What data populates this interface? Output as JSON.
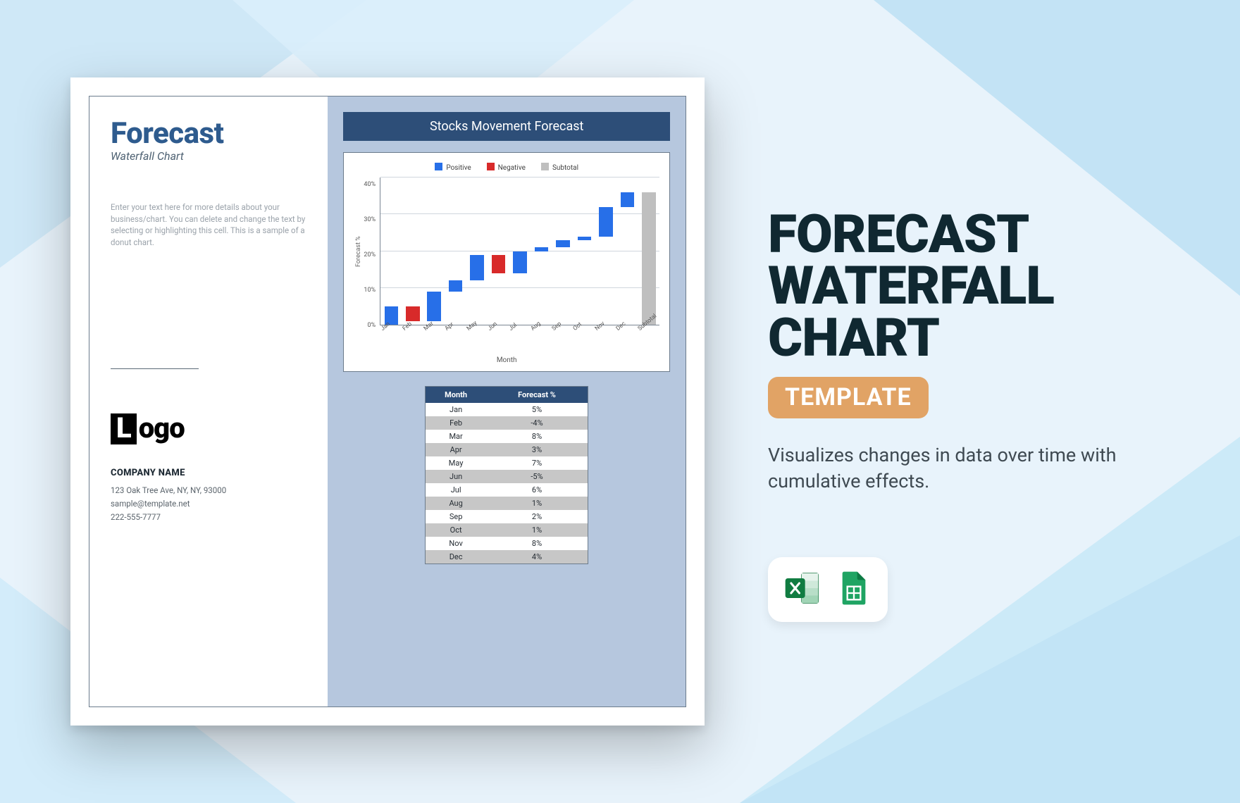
{
  "left": {
    "title": "Forecast",
    "subtitle": "Waterfall Chart",
    "description": "Enter your text here for more details about your business/chart. You can delete and change the text by selecting or highlighting this cell. This is a sample of a donut chart.",
    "logo_letter": "L",
    "logo_rest": "ogo",
    "company_name": "COMPANY NAME",
    "address": "123 Oak Tree Ave, NY, NY, 93000",
    "email": "sample@template.net",
    "phone": "222-555-7777"
  },
  "chart": {
    "header": "Stocks Movement Forecast",
    "legend": {
      "positive": "Positive",
      "negative": "Negative",
      "subtotal": "Subtotal"
    },
    "ylabel": "Forecast %",
    "xlabel": "Month",
    "yticks": [
      "40%",
      "30%",
      "20%",
      "10%",
      "0%"
    ],
    "table_headers": {
      "month": "Month",
      "value": "Forecast %"
    }
  },
  "chart_data": {
    "type": "waterfall",
    "title": "Stocks Movement Forecast",
    "ylabel": "Forecast %",
    "xlabel": "Month",
    "ylim": [
      0,
      40
    ],
    "series": [
      {
        "month": "Jan",
        "value": 5,
        "display": "5%",
        "kind": "pos"
      },
      {
        "month": "Feb",
        "value": -4,
        "display": "-4%",
        "kind": "neg"
      },
      {
        "month": "Mar",
        "value": 8,
        "display": "8%",
        "kind": "pos"
      },
      {
        "month": "Apr",
        "value": 3,
        "display": "3%",
        "kind": "pos"
      },
      {
        "month": "May",
        "value": 7,
        "display": "7%",
        "kind": "pos"
      },
      {
        "month": "Jun",
        "value": -5,
        "display": "-5%",
        "kind": "neg"
      },
      {
        "month": "Jul",
        "value": 6,
        "display": "6%",
        "kind": "pos"
      },
      {
        "month": "Aug",
        "value": 1,
        "display": "1%",
        "kind": "pos"
      },
      {
        "month": "Sep",
        "value": 2,
        "display": "2%",
        "kind": "pos"
      },
      {
        "month": "Oct",
        "value": 1,
        "display": "1%",
        "kind": "pos"
      },
      {
        "month": "Nov",
        "value": 8,
        "display": "8%",
        "kind": "pos"
      },
      {
        "month": "Dec",
        "value": 4,
        "display": "4%",
        "kind": "pos"
      }
    ],
    "subtotal_label": "Subtotal",
    "subtotal_value": 36
  },
  "side": {
    "line1": "FORECAST",
    "line2": "WATERFALL",
    "line3": "CHART",
    "pill": "TEMPLATE",
    "caption": "Visualizes changes in data over time with cumulative effects."
  },
  "icons": {
    "excel_name": "excel-icon",
    "sheets_name": "google-sheets-icon"
  }
}
